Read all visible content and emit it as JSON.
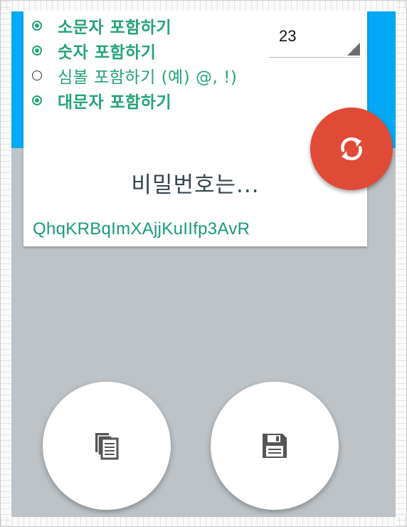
{
  "options": [
    {
      "label": "소문자 포함하기",
      "checked": true
    },
    {
      "label": "숫자 포함하기",
      "checked": true
    },
    {
      "label": "심볼 포함하기 (예) @, !)",
      "checked": false
    },
    {
      "label": "대문자 포함하기",
      "checked": true
    }
  ],
  "length": {
    "value": "23"
  },
  "result": {
    "heading": "비밀번호는...",
    "password": "QhqKRBqImXAjjKuIIfp3AvR"
  },
  "icons": {
    "refresh": "refresh-icon",
    "copy": "copy-icon",
    "save": "save-icon"
  },
  "colors": {
    "accent_blue": "#03a9f4",
    "option_green": "#24a37a",
    "fab_red": "#e04b37",
    "background_gray": "#bdc3c7"
  }
}
